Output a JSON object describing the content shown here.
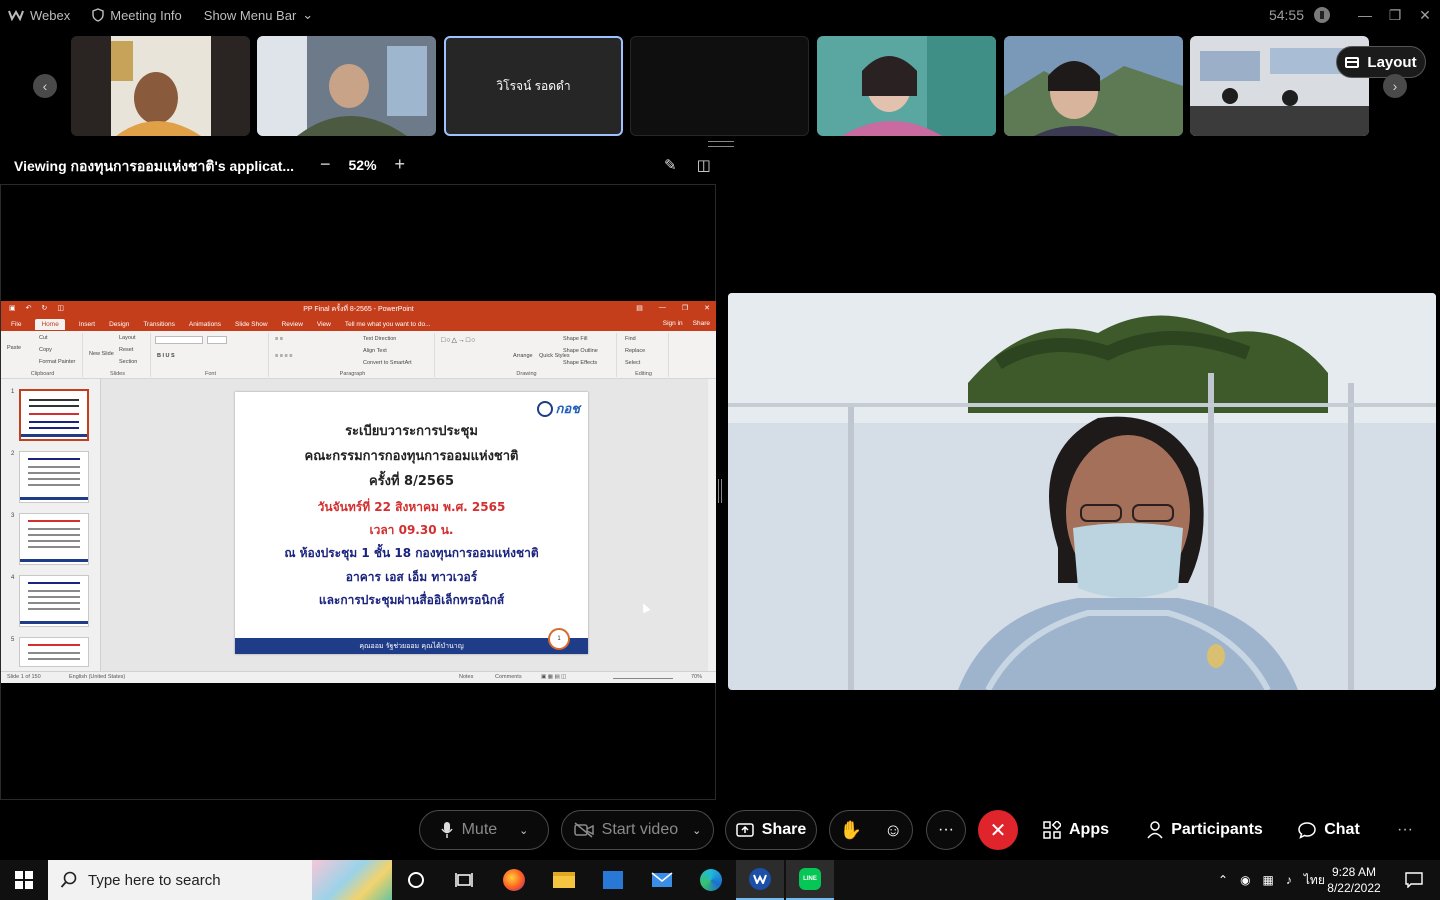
{
  "topbar": {
    "app_name": "Webex",
    "meeting_info": "Meeting Info",
    "menu_bar": "Show Menu Bar",
    "timer": "54:55"
  },
  "filmstrip": {
    "participants": [
      {
        "label": "",
        "kind": "video"
      },
      {
        "label": "",
        "kind": "video"
      },
      {
        "label": "วิโรจน์ รอดดำ",
        "kind": "name",
        "active": true
      },
      {
        "label": "",
        "kind": "empty"
      },
      {
        "label": "",
        "kind": "video"
      },
      {
        "label": "",
        "kind": "video"
      },
      {
        "label": "",
        "kind": "video"
      }
    ],
    "layout_label": "Layout"
  },
  "share_bar": {
    "viewing_text": "Viewing กองทุนการออมแห่งชาติ's applicat...",
    "zoom": "52%",
    "zoom_out": "−",
    "zoom_in": "+"
  },
  "powerpoint": {
    "title": "PP Final ครั้งที่ 8-2565 - PowerPoint",
    "tabs": [
      "File",
      "Home",
      "Insert",
      "Design",
      "Transitions",
      "Animations",
      "Slide Show",
      "Review",
      "View",
      "Tell me what you want to do..."
    ],
    "sign_in": "Sign in",
    "share": "Share",
    "ribbon": {
      "clipboard": {
        "label": "Clipboard",
        "paste": "Paste",
        "cut": "Cut",
        "copy": "Copy",
        "format_painter": "Format Painter"
      },
      "slides": {
        "label": "Slides",
        "new_slide": "New Slide",
        "layout": "Layout",
        "reset": "Reset",
        "section": "Section"
      },
      "font": {
        "label": "Font"
      },
      "paragraph": {
        "label": "Paragraph",
        "text_direction": "Text Direction",
        "align_text": "Align Text",
        "convert": "Convert to SmartArt"
      },
      "drawing": {
        "label": "Drawing",
        "arrange": "Arrange",
        "quick_styles": "Quick Styles",
        "shape_fill": "Shape Fill",
        "shape_outline": "Shape Outline",
        "shape_effects": "Shape Effects"
      },
      "editing": {
        "label": "Editing",
        "find": "Find",
        "replace": "Replace",
        "select": "Select"
      }
    },
    "slide_numbers": [
      "1",
      "2",
      "3",
      "4",
      "5"
    ],
    "slide": {
      "logo": "กอช",
      "line1": "ระเบียบวาระการประชุม",
      "line2": "คณะกรรมการกองทุนการออมแห่งชาติ",
      "line3": "ครั้งที่ 8/2565",
      "line4": "วันจันทร์ที่ 22 สิงหาคม พ.ศ. 2565",
      "line5": "เวลา 09.30 น.",
      "line6": "ณ ห้องประชุม 1 ชั้น 18 กองทุนการออมแห่งชาติ",
      "line7": "อาคาร เอส เอ็ม ทาวเวอร์",
      "line8": "และการประชุมผ่านสื่ออิเล็กทรอนิกส์",
      "footer": "คุณออม รัฐช่วยออม คุณได้บำนาญ",
      "page": "1"
    },
    "status": {
      "slide_of": "Slide 1 of 150",
      "language": "English (United States)",
      "notes": "Notes",
      "comments": "Comments",
      "zoom": "70%"
    }
  },
  "controls": {
    "mute": "Mute",
    "start_video": "Start video",
    "share": "Share",
    "apps": "Apps",
    "participants": "Participants",
    "chat": "Chat",
    "more": "···"
  },
  "taskbar": {
    "search_placeholder": "Type here to search",
    "language": "ไทย",
    "time": "9:28 AM",
    "date": "8/22/2022"
  }
}
